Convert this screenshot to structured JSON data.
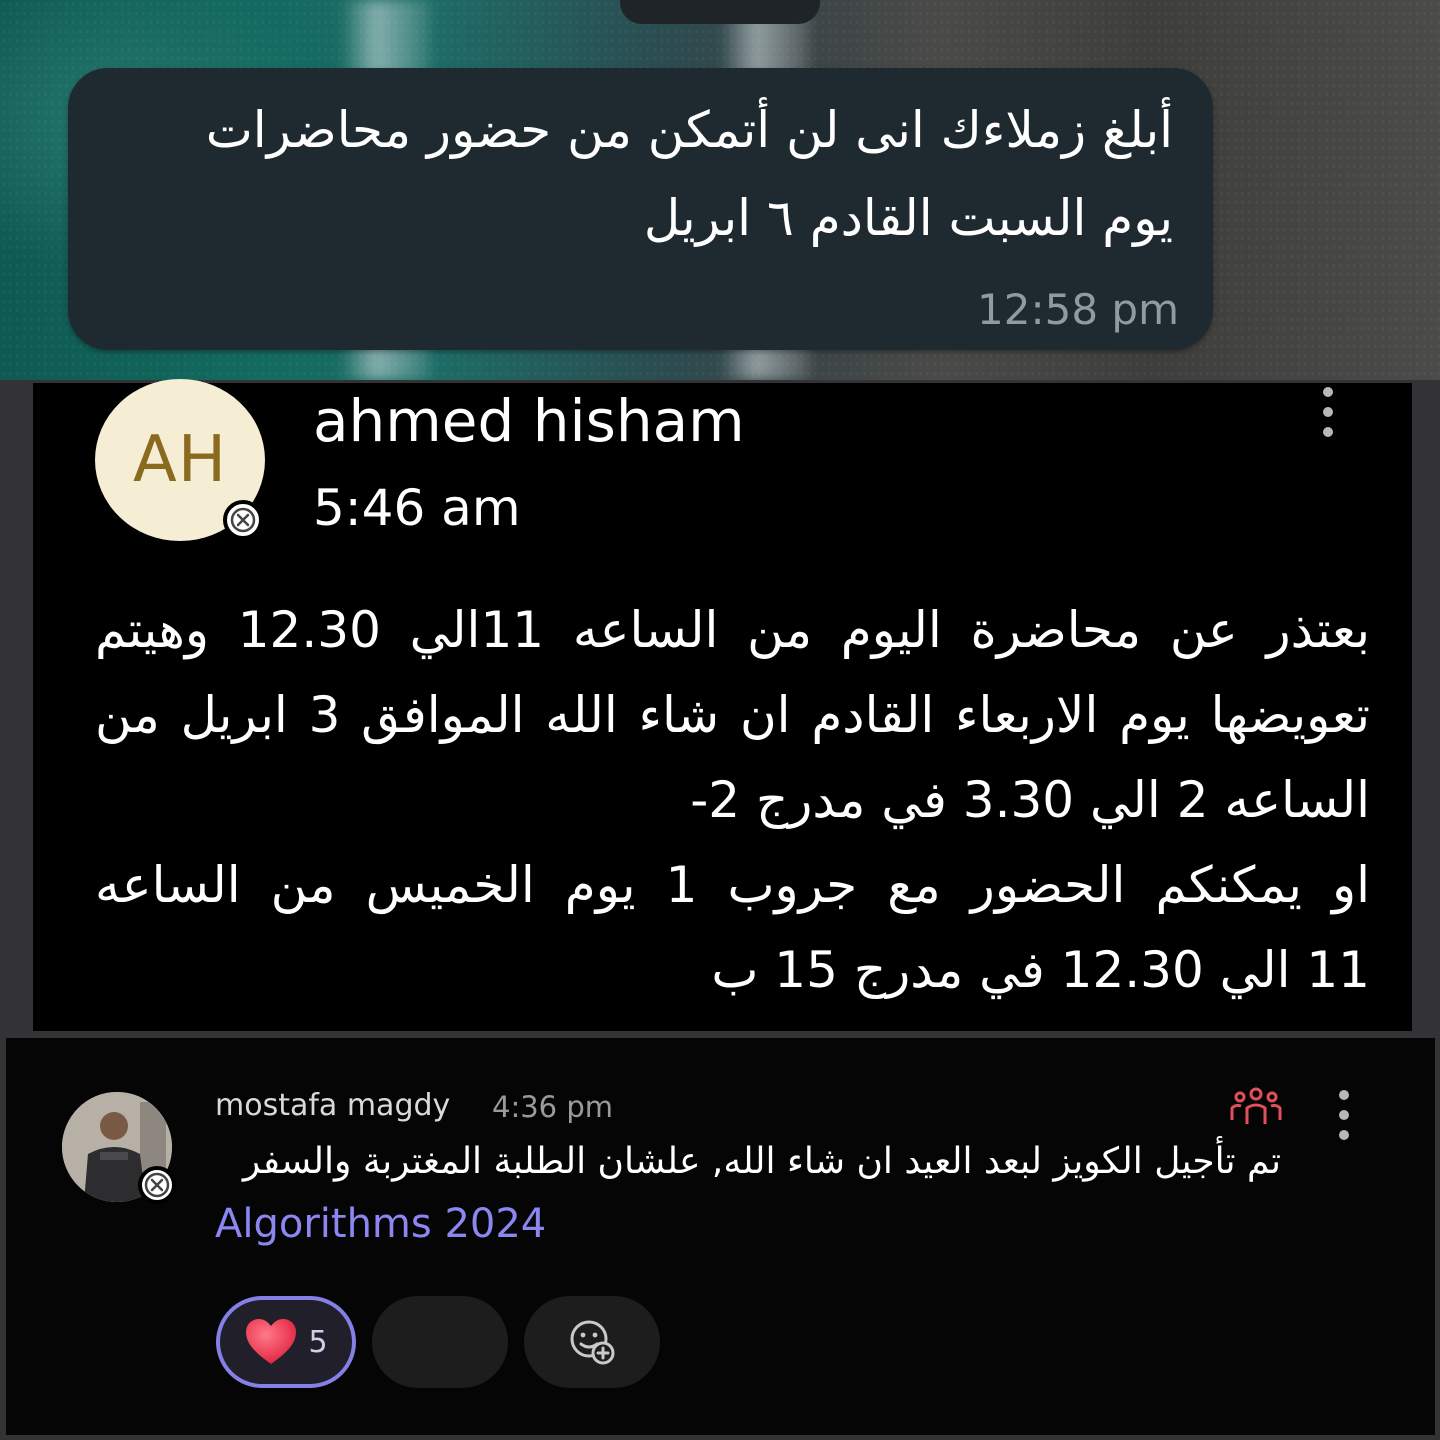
{
  "message1": {
    "lines": [
      "أبلغ زملاءك انى لن أتمكن من حضور محاضرات",
      "يوم السبت القادم  ٦ ابريل"
    ],
    "time": "12:58 pm"
  },
  "post": {
    "avatar_initials": "AH",
    "author": "ahmed hisham",
    "time": "5:46 am",
    "body_lines": [
      "بعتذر عن محاضرة اليوم من الساعه 11الي 12.30 وهيتم",
      "تعويضها يوم الاربعاء القادم ان شاء الله الموافق 3 ابريل من",
      "الساعه 2 الي 3.30 في مدرج 2-",
      "او يمكنكم الحضور مع جروب 1 يوم الخميس من الساعه",
      "11 الي 12.30 في مدرج 15 ب"
    ],
    "icons": {
      "status": "x-circle-icon",
      "more": "more-vertical-icon"
    }
  },
  "teams_message": {
    "author": "mostafa magdy",
    "time": "4:36 pm",
    "text": "تم تأجيل الكويز لبعد العيد ان شاء الله, علشان الطلبة المغتربة والسفر",
    "channel": "Algorithms 2024",
    "reactions": [
      {
        "emoji": "heart-icon",
        "count": "5",
        "active": true
      },
      {
        "emoji": "",
        "count": "",
        "active": false
      },
      {
        "emoji": "add-reaction-icon",
        "count": "",
        "active": false
      }
    ],
    "colors": {
      "accent": "#8580e6",
      "teams_icon": "#e0505a"
    }
  }
}
